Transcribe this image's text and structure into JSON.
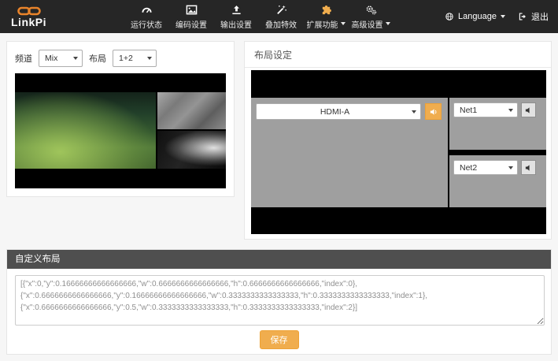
{
  "navbar": {
    "brand": "LinkPi",
    "items": [
      {
        "label": "运行状态"
      },
      {
        "label": "编码设置"
      },
      {
        "label": "输出设置"
      },
      {
        "label": "叠加特效"
      },
      {
        "label": "扩展功能"
      },
      {
        "label": "高级设置"
      }
    ],
    "language": "Language",
    "logout": "退出"
  },
  "preview": {
    "channel_label": "频道",
    "channel_value": "Mix",
    "layout_label": "布局",
    "layout_value": "1+2"
  },
  "layout_editor": {
    "title": "布局设定",
    "main_source": "HDMI-A",
    "sub_sources": [
      "Net1",
      "Net2"
    ]
  },
  "custom_layout": {
    "title": "自定义布局",
    "value": "[{\"x\":0,\"y\":0.16666666666666666,\"w\":0.6666666666666666,\"h\":0.6666666666666666,\"index\":0},\n{\"x\":0.6666666666666666,\"y\":0.16666666666666666,\"w\":0.3333333333333333,\"h\":0.3333333333333333,\"index\":1},\n{\"x\":0.6666666666666666,\"y\":0.5,\"w\":0.3333333333333333,\"h\":0.3333333333333333,\"index\":2}]",
    "save": "保存"
  },
  "colors": {
    "accent": "#f0ad4e",
    "brand_orange": "#e8832a",
    "navbar_bg": "#262626"
  }
}
